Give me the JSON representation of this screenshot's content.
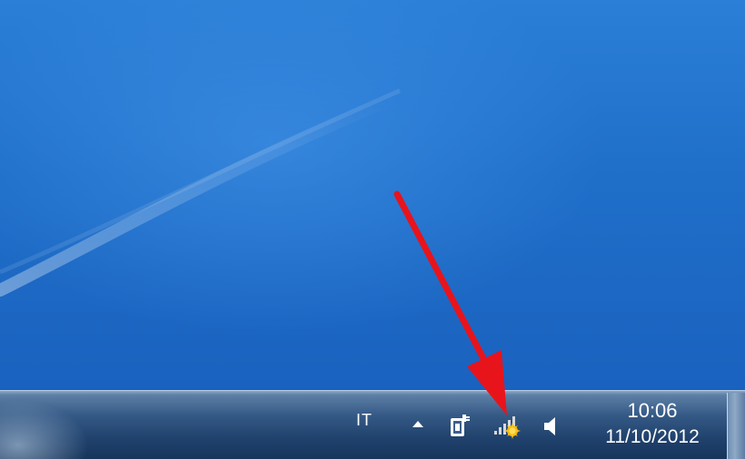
{
  "tray": {
    "language": "IT",
    "icons": {
      "show_hidden": "chevron-up-icon",
      "power": "power-plug-icon",
      "network": "network-signal-icon",
      "volume": "speaker-icon"
    }
  },
  "clock": {
    "time": "10:06",
    "date": "11/10/2012"
  },
  "colors": {
    "desktop": "#1f6fc9",
    "taskbar": "#2a4c78",
    "arrow": "#e8141c",
    "network_badge": "#f4b400"
  }
}
